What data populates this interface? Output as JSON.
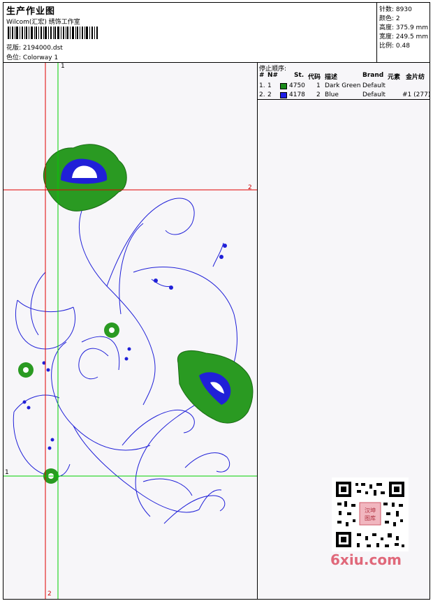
{
  "header": {
    "title": "生产作业图",
    "subtitle": "Wilcom(汇宏) 绣饰工作室",
    "design_label": "花版:",
    "design_value": "2194000.dst",
    "color_label": "色位:",
    "color_value": "Colorway 1"
  },
  "stats": {
    "stitches_label": "针数:",
    "stitches": "8930",
    "colors_label": "颜色:",
    "colors": "2",
    "height_label": "高度:",
    "height": "375.9 mm",
    "width_label": "宽度:",
    "width": "249.5 mm",
    "scale_label": "比例:",
    "scale": "0.48"
  },
  "stop_sequence": {
    "caption": "停止顺序:",
    "columns": [
      "#",
      "N#",
      "St.",
      "代码",
      "描述",
      "Brand",
      "元素",
      "金片纺"
    ],
    "rows": [
      {
        "idx": "1.",
        "n": "1",
        "color": "#1a8a1a",
        "st": "4750",
        "code": "1",
        "desc": "Dark Green",
        "brand": "Default",
        "element": ""
      },
      {
        "idx": "2.",
        "n": "2",
        "color": "#1d1de6",
        "st": "4178",
        "code": "2",
        "desc": "Blue",
        "brand": "Default",
        "element": "#1 (277)"
      }
    ]
  },
  "guides": {
    "v_green": "1",
    "h_red": "2",
    "h_green": "1",
    "v_red": "2"
  },
  "watermark": "6xiu.com",
  "qr_badge": "汉坤图库"
}
